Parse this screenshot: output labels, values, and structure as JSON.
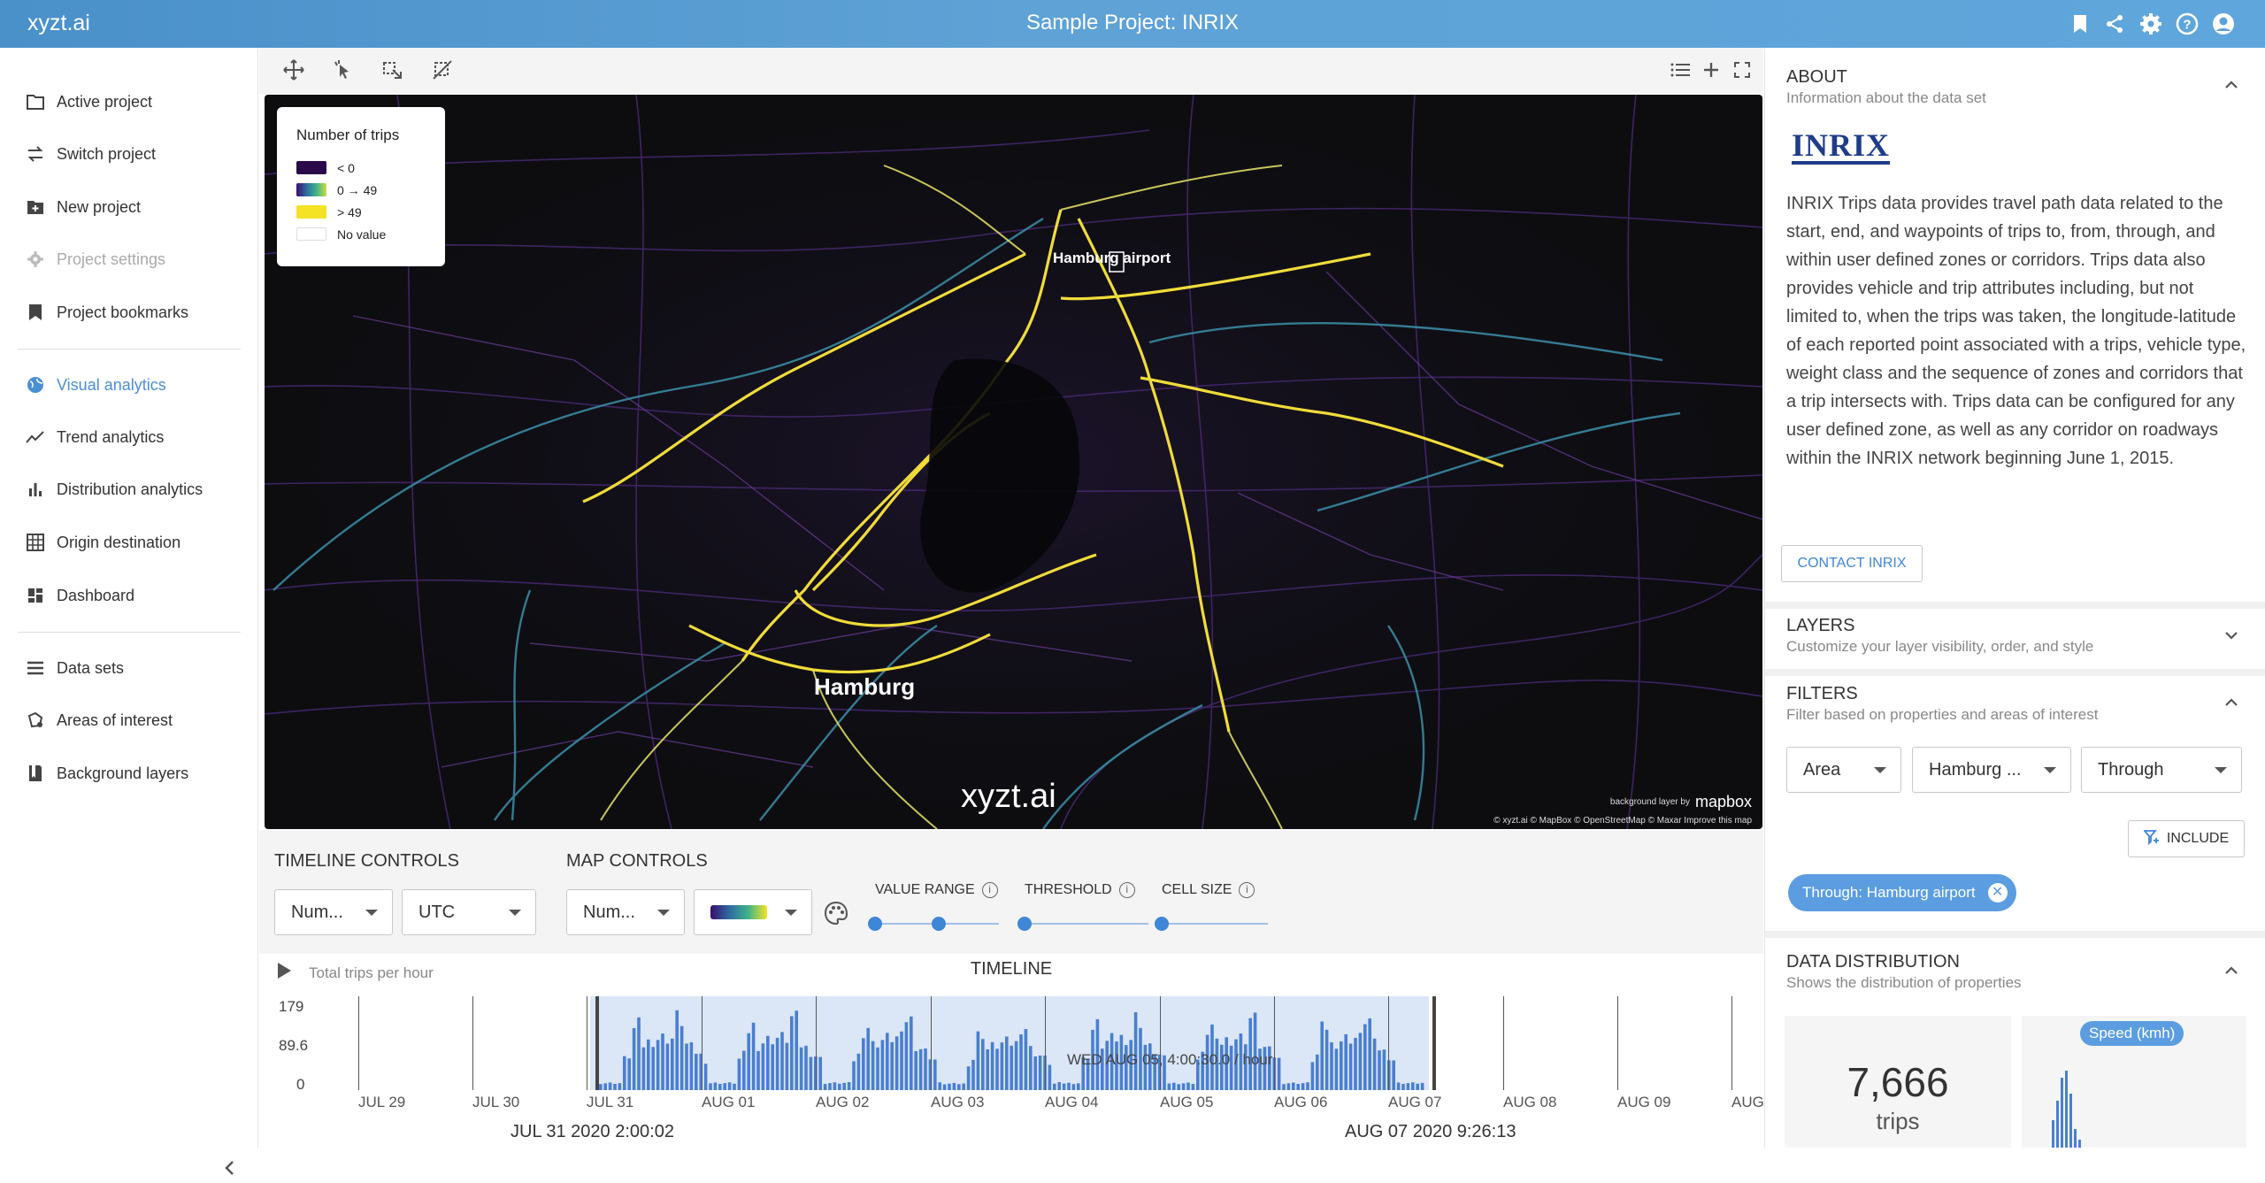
{
  "app": {
    "brand": "xyzt.ai",
    "project_title": "Sample Project: INRIX",
    "header_icons": [
      "bookmark-icon",
      "share-icon",
      "settings-icon",
      "help-icon",
      "account-icon"
    ]
  },
  "sidebar": {
    "items": [
      {
        "label": "Active project",
        "icon": "folder-icon",
        "state": "normal"
      },
      {
        "label": "Switch project",
        "icon": "swap-icon",
        "state": "normal"
      },
      {
        "label": "New project",
        "icon": "new-folder-icon",
        "state": "normal"
      },
      {
        "label": "Project settings",
        "icon": "gear-icon",
        "state": "disabled"
      },
      {
        "label": "Project bookmarks",
        "icon": "bookmark-icon",
        "state": "normal"
      },
      {
        "label": "Visual analytics",
        "icon": "globe-icon",
        "state": "active"
      },
      {
        "label": "Trend analytics",
        "icon": "trend-icon",
        "state": "normal"
      },
      {
        "label": "Distribution analytics",
        "icon": "bar-chart-icon",
        "state": "normal"
      },
      {
        "label": "Origin destination",
        "icon": "grid-icon",
        "state": "normal"
      },
      {
        "label": "Dashboard",
        "icon": "dashboard-icon",
        "state": "normal"
      },
      {
        "label": "Data sets",
        "icon": "list-icon",
        "state": "normal"
      },
      {
        "label": "Areas of interest",
        "icon": "area-icon",
        "state": "normal"
      },
      {
        "label": "Background layers",
        "icon": "map-icon",
        "state": "normal"
      }
    ]
  },
  "map": {
    "legend": {
      "title": "Number of trips",
      "items": [
        {
          "label": "< 0",
          "color": "#2a0a4a"
        },
        {
          "label": "0 → 49",
          "color": "gradient"
        },
        {
          "label": "> 49",
          "color": "#f4e225"
        },
        {
          "label": "No value",
          "color": "#ffffff"
        }
      ]
    },
    "labels": {
      "airport": "Hamburg airport",
      "city": "Hamburg"
    },
    "watermark": "xyzt.ai",
    "attribution": "© xyzt.ai © MapBox © OpenStreetMap © Maxar Improve this map",
    "background_by": "background layer by",
    "mapbox": "mapbox"
  },
  "controls": {
    "timeline_title": "TIMELINE CONTROLS",
    "timeline_metric": "Num...",
    "timezone": "UTC",
    "map_title": "MAP CONTROLS",
    "map_metric": "Num...",
    "value_range_label": "VALUE RANGE",
    "threshold_label": "THRESHOLD",
    "cell_size_label": "CELL SIZE",
    "value_range": [
      0,
      0.35
    ],
    "threshold": 0,
    "cell_size": 0
  },
  "timeline": {
    "caption": "Total trips per hour",
    "title": "TIMELINE",
    "y_ticks": [
      "179",
      "89.6",
      "0"
    ],
    "x_ticks": [
      "JUL 29",
      "JUL 30",
      "JUL 31",
      "AUG 01",
      "AUG 02",
      "AUG 03",
      "AUG 04",
      "AUG 05",
      "AUG 06",
      "AUG 07",
      "AUG 08",
      "AUG 09",
      "AUG"
    ],
    "hover_text": "WED AUG 05, 4:00:30.0 / hour",
    "range_start": "JUL 31 2020 2:00:02",
    "range_end": "AUG 07 2020 9:26:13"
  },
  "right_panel": {
    "about": {
      "title": "ABOUT",
      "subtitle": "Information about the data set",
      "logo": "INRIX",
      "text": "INRIX Trips data provides travel path data related to the start, end, and waypoints of trips to, from, through, and within user defined zones or corridors. Trips data also provides vehicle and trip attributes including, but not limited to, when the trips was taken, the longitude-latitude of each reported point associated with a trips, vehicle type, weight class and the sequence of zones and corridors that a trip intersects with. Trips data can be configured for any user defined zone, as well as any corridor on roadways within the INRIX network beginning June 1, 2015.",
      "contact_button": "CONTACT INRIX"
    },
    "layers": {
      "title": "LAYERS",
      "subtitle": "Customize your layer visibility, order, and style"
    },
    "filters": {
      "title": "FILTERS",
      "subtitle": "Filter based on properties and areas of interest",
      "selects": [
        "Area",
        "Hamburg ...",
        "Through"
      ],
      "include_button": "INCLUDE",
      "chip": "Through: Hamburg airport"
    },
    "distribution": {
      "title": "DATA DISTRIBUTION",
      "subtitle": "Shows the distribution of properties",
      "value": "7,666",
      "unit": "trips",
      "badge": "Speed (kmh)"
    }
  }
}
